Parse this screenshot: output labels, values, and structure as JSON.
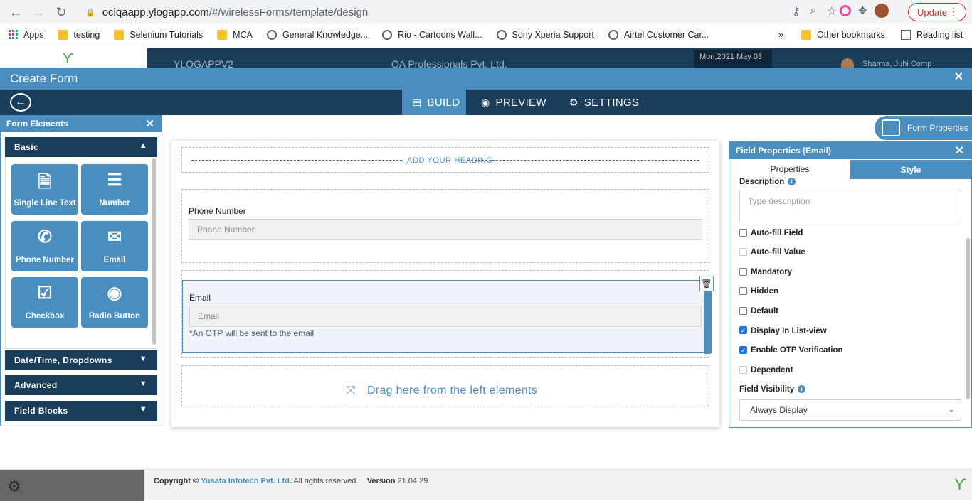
{
  "browser": {
    "url_host": "ociqaapp.ylogapp.com",
    "url_path": "/#/wirelessForms/template/design",
    "update_label": "Update",
    "bookmarks": [
      "Apps",
      "testing",
      "Selenium Tutorials",
      "MCA",
      "General Knowledge...",
      "Rio - Cartoons Wall...",
      "Sony Xperia Support",
      "Airtel Customer Car..."
    ],
    "other_bookmarks": "Other bookmarks",
    "reading_list": "Reading list",
    "overflow": "»"
  },
  "app_header": {
    "app_name": "YLOGAPPV2",
    "company": "QA Professionals Pvt. Ltd.",
    "date": "Mon,2021 May 03",
    "user": "Sharma, Juhi Comp"
  },
  "create_form": {
    "title": "Create Form",
    "close": "✕"
  },
  "tabs": [
    {
      "label": "BUILD",
      "icon": "build-icon"
    },
    {
      "label": "PREVIEW",
      "icon": "eye-icon"
    },
    {
      "label": "SETTINGS",
      "icon": "gear-icon"
    }
  ],
  "form_elements": {
    "title": "Form Elements",
    "close": "✕",
    "sections": {
      "basic": "Basic",
      "datetime": "Date/Time, Dropdowns",
      "advanced": "Advanced",
      "field_blocks": "Field Blocks"
    },
    "tiles": [
      {
        "label": "Single Line Text",
        "icon": "document-icon"
      },
      {
        "label": "Number",
        "icon": "numbered-list-icon"
      },
      {
        "label": "Phone Number",
        "icon": "phone-icon"
      },
      {
        "label": "Email",
        "icon": "envelope-icon"
      },
      {
        "label": "Checkbox",
        "icon": "checkbox-icon"
      },
      {
        "label": "Radio Button",
        "icon": "radio-icon"
      }
    ]
  },
  "canvas": {
    "heading": "ADD YOUR HEADING",
    "phone_label": "Phone Number",
    "phone_placeholder": "Phone Number",
    "email_label": "Email",
    "email_placeholder": "Email",
    "otp_note": "*An OTP will be sent to the email",
    "drag_text": "Drag here from the left elements"
  },
  "form_properties_button": "Form Properties",
  "field_properties": {
    "title": "Field Properties (Email)",
    "close": "✕",
    "tab_properties": "Properties",
    "tab_style": "Style",
    "description_label": "Description",
    "description_placeholder": "Type description",
    "options": [
      {
        "label": "Auto-fill Field",
        "checked": false,
        "disabled": false
      },
      {
        "label": "Auto-fill Value",
        "checked": false,
        "disabled": true
      },
      {
        "label": "Mandatory",
        "checked": false,
        "disabled": false
      },
      {
        "label": "Hidden",
        "checked": false,
        "disabled": false
      },
      {
        "label": "Default",
        "checked": false,
        "disabled": false
      },
      {
        "label": "Display In List-view",
        "checked": true,
        "disabled": false
      },
      {
        "label": "Enable OTP Verification",
        "checked": true,
        "disabled": false
      },
      {
        "label": "Dependent",
        "checked": false,
        "disabled": true
      }
    ],
    "visibility_label": "Field Visibility",
    "visibility_value": "Always Display"
  },
  "footer": {
    "copyright_prefix": "Copyright ©",
    "company": "Yusata Infotech Pvt. Ltd.",
    "rights": "All rights reserved.",
    "version_label": "Version",
    "version": "21.04.29"
  },
  "colors": {
    "accent": "#4a8dbf",
    "dark": "#1a3d5c"
  }
}
